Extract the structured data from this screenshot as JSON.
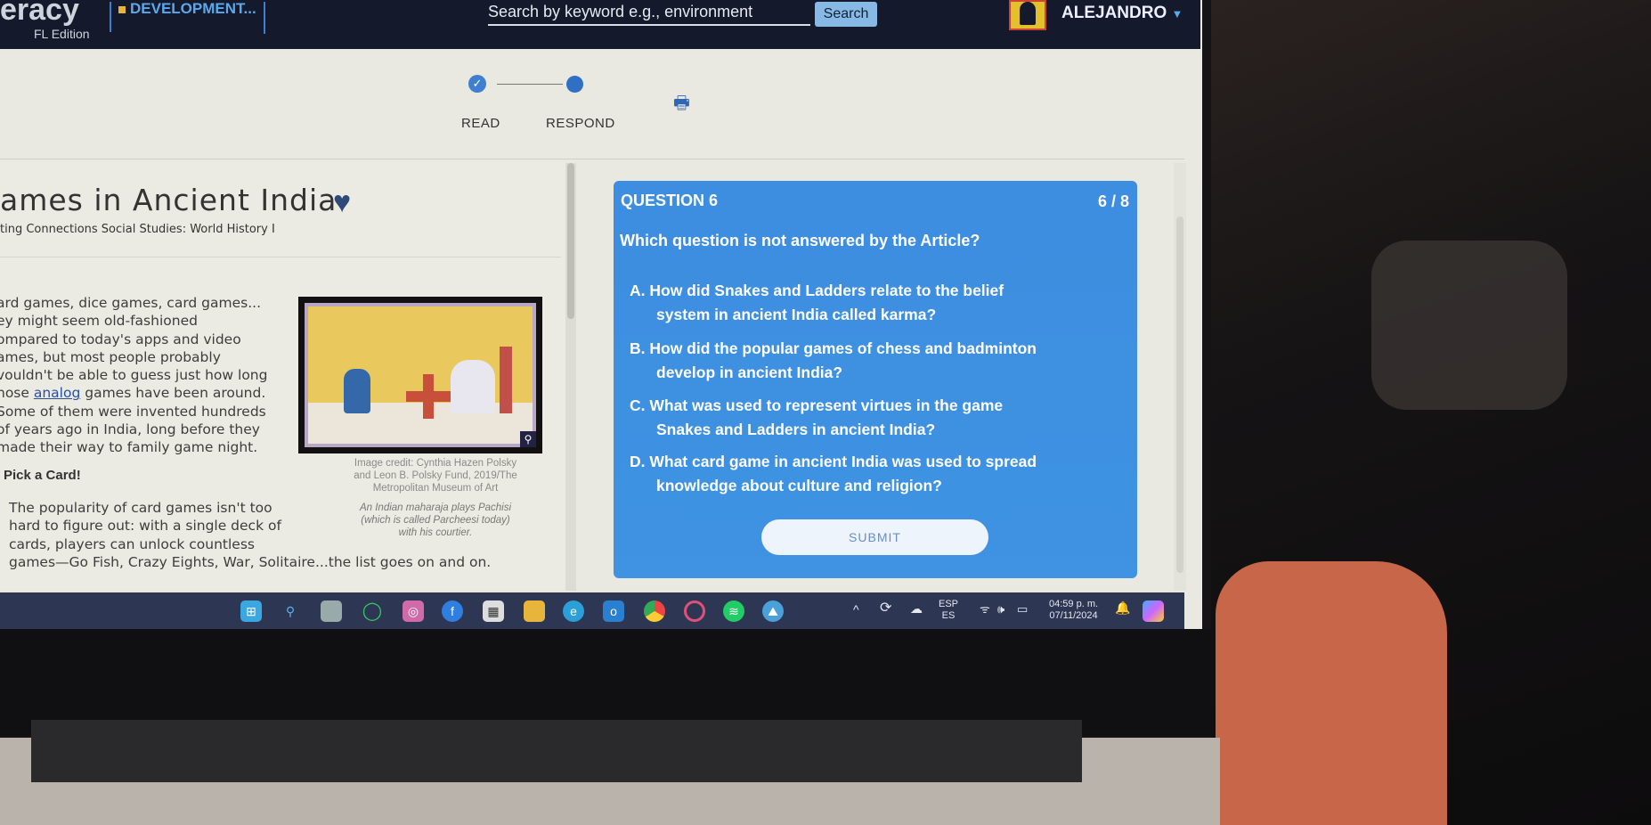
{
  "nav": {
    "logo": "eracy",
    "edition": "FL Edition",
    "dev_label": "DEVELOPMENT...",
    "search_placeholder": "Search by keyword e.g., environment",
    "search_button": "Search",
    "user": "ALEJANDRO"
  },
  "steps": {
    "read": "READ",
    "respond": "RESPOND"
  },
  "article": {
    "title": "ames in Ancient India",
    "subtitle": "ting Connections Social Studies: World History I",
    "para1": [
      "ard games, dice games, card games...",
      "ey might seem old-fashioned",
      "ompared to today's apps and video",
      "ames, but most people probably",
      "vouldn't be able to guess just how long",
      "hose ",
      "analog",
      " games have been around.",
      "Some of them were invented hundreds",
      "of years ago in India, long before they",
      "made their way to family game night."
    ],
    "heading": "Pick a Card!",
    "para2": [
      "The popularity of card games isn't too",
      "hard to figure out: with a single deck of",
      "cards, players can unlock countless",
      "games—Go Fish, Crazy Eights, War, Solitaire...the list goes on and on."
    ],
    "credit": [
      "Image credit: Cynthia Hazen Polsky",
      "and Leon B. Polsky Fund, 2019/The",
      "Metropolitan Museum of Art"
    ],
    "caption": [
      "An Indian maharaja plays Pachisi",
      "(which is called Parcheesi today)",
      "with his courtier."
    ]
  },
  "question": {
    "label": "QUESTION 6",
    "counter": "6 / 8",
    "text_pre": "Which question is ",
    "text_em": "not",
    "text_post": " answered by the Article?",
    "options": [
      {
        "l1": "A. How did Snakes and Ladders relate to the belief",
        "l2": "system in ancient India called karma?"
      },
      {
        "l1": "B. How did the popular games of chess and badminton",
        "l2": "develop in ancient India?"
      },
      {
        "l1": "C. What was used to represent virtues in the game",
        "l2": "Snakes and Ladders in ancient India?"
      },
      {
        "l1": "D. What card game in ancient India was used to spread",
        "l2": "knowledge about culture and religion?"
      }
    ],
    "submit": "SUBMIT",
    "card_color": "#3d8de0"
  },
  "taskbar": {
    "lang1": "ESP",
    "lang2": "ES",
    "time": "04:59 p. m.",
    "date": "07/11/2024",
    "apps": [
      "windows-start",
      "search",
      "task-view",
      "whatsapp",
      "instagram",
      "facebook",
      "store",
      "file-explorer",
      "edge",
      "outlook",
      "chrome",
      "opera",
      "spotify",
      "app"
    ]
  }
}
